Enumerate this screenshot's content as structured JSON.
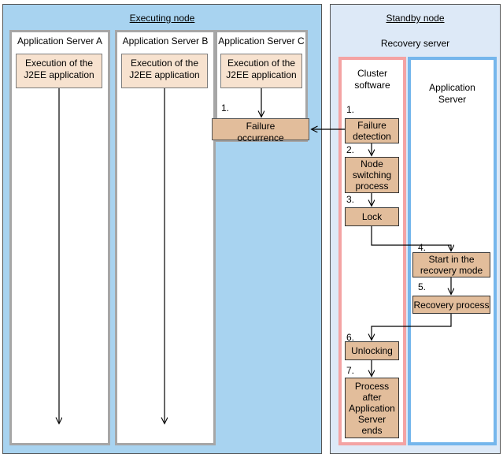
{
  "executing_node": {
    "title": "Executing node",
    "servers": [
      {
        "label": "Application Server A",
        "exec_line1": "Execution of the",
        "exec_line2": "J2EE application"
      },
      {
        "label": "Application Server B",
        "exec_line1": "Execution of the",
        "exec_line2": "J2EE application"
      },
      {
        "label": "Application Server C",
        "exec_line1": "Execution of the",
        "exec_line2": "J2EE application"
      }
    ],
    "failure": {
      "step": "1.",
      "line1": "Failure",
      "line2": "occurrence"
    }
  },
  "standby_node": {
    "title": "Standby node",
    "subtitle": "Recovery server",
    "cluster_software": {
      "title_line1": "Cluster",
      "title_line2": "software",
      "steps": [
        {
          "num": "1.",
          "label": "Failure\ndetection"
        },
        {
          "num": "2.",
          "label": "Node\nswitching\nprocess"
        },
        {
          "num": "3.",
          "label": "Lock"
        },
        {
          "num": "6.",
          "label": "Unlocking"
        },
        {
          "num": "7.",
          "label": "Process\nafter\nApplication\nServer\nends"
        }
      ]
    },
    "application_server": {
      "title_line1": "Application",
      "title_line2": "Server",
      "steps": [
        {
          "num": "4.",
          "label": "Start in the\nrecovery mode"
        },
        {
          "num": "5.",
          "label": "Recovery process"
        }
      ]
    }
  },
  "steps_text": {
    "failure_detection_l1": "Failure",
    "failure_detection_l2": "detection",
    "node_switching_l1": "Node",
    "node_switching_l2": "switching",
    "node_switching_l3": "process",
    "lock": "Lock",
    "unlocking": "Unlocking",
    "process_after_l1": "Process",
    "process_after_l2": "after",
    "process_after_l3": "Application",
    "process_after_l4": "Server",
    "process_after_l5": "ends",
    "start_recovery_l1": "Start in the",
    "start_recovery_l2": "recovery mode",
    "recovery_process": "Recovery process",
    "num1": "1.",
    "num2": "2.",
    "num3": "3.",
    "num4": "4.",
    "num5": "5.",
    "num6": "6.",
    "num7": "7."
  },
  "colors": {
    "executing_panel_bg": "#a8d3f0",
    "standby_panel_bg": "#dde9f7",
    "process_box_bg": "#e2bd9b",
    "exec_box_bg": "#f7e2cf",
    "cluster_border": "#f4a3a3",
    "appserver_border": "#75b6ec",
    "server_border": "#a6a6a6"
  }
}
